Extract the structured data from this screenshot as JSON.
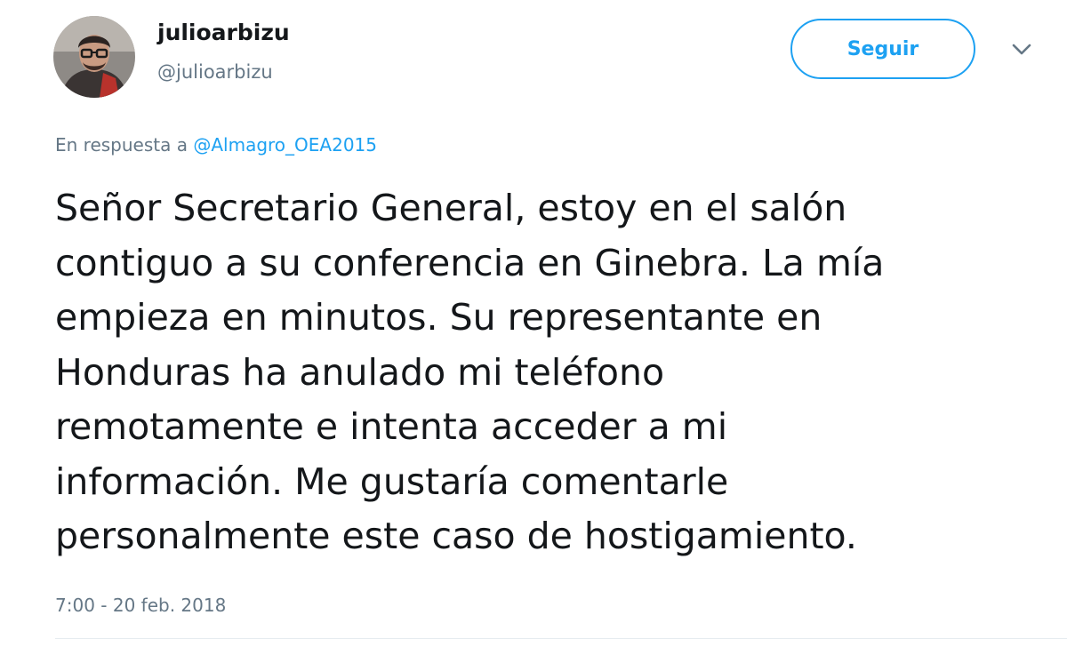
{
  "user": {
    "display_name": "julioarbizu",
    "screen_name": "@julioarbizu",
    "avatar_icon": "profile-photo"
  },
  "actions": {
    "follow_label": "Seguir",
    "menu_icon": "chevron-down-icon"
  },
  "reply": {
    "prefix": "En respuesta a",
    "mention": "@Almagro_OEA2015"
  },
  "tweet": {
    "lines": [
      "Señor Secretario General, estoy en el salón",
      "contiguo a su conferencia en Ginebra. La mía",
      "empieza en minutos. Su representante en",
      "Honduras ha anulado mi teléfono",
      "remotamente e intenta acceder a mi",
      "información. Me gustaría comentarle",
      "personalmente este caso de hostigamiento."
    ],
    "timestamp": "7:00 - 20 feb. 2018"
  },
  "colors": {
    "accent": "#1da1f2",
    "secondary_text": "#657786",
    "primary_text": "#14171a",
    "divider": "#e6ecf0"
  }
}
